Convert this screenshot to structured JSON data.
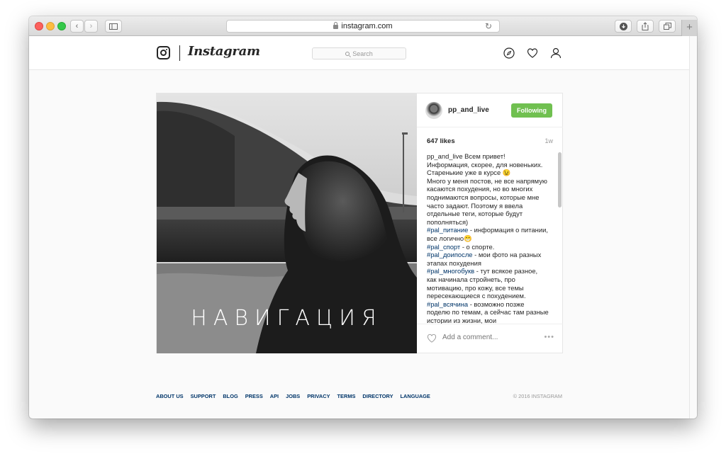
{
  "browser": {
    "url": "instagram.com",
    "new_tab_label": "+"
  },
  "header": {
    "wordmark": "Instagram",
    "search_placeholder": "Search"
  },
  "post": {
    "username": "pp_and_live",
    "follow_label": "Following",
    "likes": "647 likes",
    "age": "1w",
    "image_caption": "НАВИГАЦИЯ",
    "caption_parts": [
      {
        "t": "pp_and_live",
        "k": "author"
      },
      {
        "t": " Всем привет! Информация, скорее, для новеньких. Старенькие уже в курсе 😉",
        "k": "text"
      },
      {
        "t": "\nМного у меня постов, не все напрямую касаются похудения, но во многих поднимаются вопросы, которые мне часто задают. Поэтому я ввела отдельные теги, которые будут пополняться)\n",
        "k": "text"
      },
      {
        "t": "#pal_питание",
        "k": "tag"
      },
      {
        "t": " - информация о питании, все логично😁\n",
        "k": "text"
      },
      {
        "t": "#pal_спорт",
        "k": "tag"
      },
      {
        "t": " - о спорте.\n",
        "k": "text"
      },
      {
        "t": "#pal_доипосле",
        "k": "tag"
      },
      {
        "t": " - мои фото на разных этапах похудения\n",
        "k": "text"
      },
      {
        "t": "#pal_многобукв",
        "k": "tag"
      },
      {
        "t": " - тут всякое разное, как начинала стройнеть, про мотивацию, про кожу, все темы пересекающиеся с похудением.\n",
        "k": "text"
      },
      {
        "t": "#pal_всячина",
        "k": "tag"
      },
      {
        "t": " - возможно позже поделю по темам, а сейчас там разные истории из жизни, мои",
        "k": "text"
      }
    ],
    "add_comment_placeholder": "Add a comment...",
    "more_label": "•••"
  },
  "footer": {
    "links": [
      "About us",
      "Support",
      "Blog",
      "Press",
      "API",
      "Jobs",
      "Privacy",
      "Terms",
      "Directory",
      "Language"
    ],
    "copyright": "© 2016 Instagram"
  },
  "colors": {
    "follow_green": "#70c050",
    "link_blue": "#003569"
  }
}
